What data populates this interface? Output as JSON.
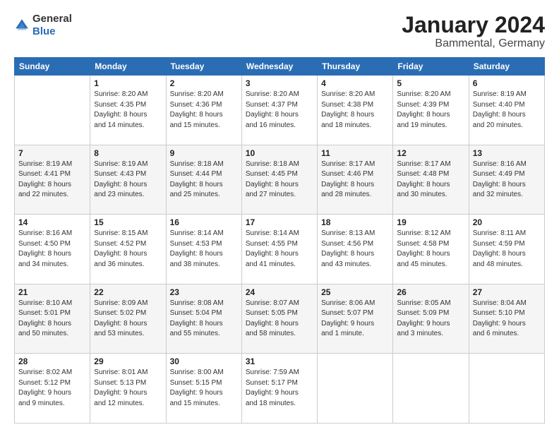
{
  "header": {
    "logo_general": "General",
    "logo_blue": "Blue",
    "month": "January 2024",
    "location": "Bammental, Germany"
  },
  "weekdays": [
    "Sunday",
    "Monday",
    "Tuesday",
    "Wednesday",
    "Thursday",
    "Friday",
    "Saturday"
  ],
  "weeks": [
    [
      {
        "day": "",
        "info": ""
      },
      {
        "day": "1",
        "info": "Sunrise: 8:20 AM\nSunset: 4:35 PM\nDaylight: 8 hours\nand 14 minutes."
      },
      {
        "day": "2",
        "info": "Sunrise: 8:20 AM\nSunset: 4:36 PM\nDaylight: 8 hours\nand 15 minutes."
      },
      {
        "day": "3",
        "info": "Sunrise: 8:20 AM\nSunset: 4:37 PM\nDaylight: 8 hours\nand 16 minutes."
      },
      {
        "day": "4",
        "info": "Sunrise: 8:20 AM\nSunset: 4:38 PM\nDaylight: 8 hours\nand 18 minutes."
      },
      {
        "day": "5",
        "info": "Sunrise: 8:20 AM\nSunset: 4:39 PM\nDaylight: 8 hours\nand 19 minutes."
      },
      {
        "day": "6",
        "info": "Sunrise: 8:19 AM\nSunset: 4:40 PM\nDaylight: 8 hours\nand 20 minutes."
      }
    ],
    [
      {
        "day": "7",
        "info": "Sunrise: 8:19 AM\nSunset: 4:41 PM\nDaylight: 8 hours\nand 22 minutes."
      },
      {
        "day": "8",
        "info": "Sunrise: 8:19 AM\nSunset: 4:43 PM\nDaylight: 8 hours\nand 23 minutes."
      },
      {
        "day": "9",
        "info": "Sunrise: 8:18 AM\nSunset: 4:44 PM\nDaylight: 8 hours\nand 25 minutes."
      },
      {
        "day": "10",
        "info": "Sunrise: 8:18 AM\nSunset: 4:45 PM\nDaylight: 8 hours\nand 27 minutes."
      },
      {
        "day": "11",
        "info": "Sunrise: 8:17 AM\nSunset: 4:46 PM\nDaylight: 8 hours\nand 28 minutes."
      },
      {
        "day": "12",
        "info": "Sunrise: 8:17 AM\nSunset: 4:48 PM\nDaylight: 8 hours\nand 30 minutes."
      },
      {
        "day": "13",
        "info": "Sunrise: 8:16 AM\nSunset: 4:49 PM\nDaylight: 8 hours\nand 32 minutes."
      }
    ],
    [
      {
        "day": "14",
        "info": "Sunrise: 8:16 AM\nSunset: 4:50 PM\nDaylight: 8 hours\nand 34 minutes."
      },
      {
        "day": "15",
        "info": "Sunrise: 8:15 AM\nSunset: 4:52 PM\nDaylight: 8 hours\nand 36 minutes."
      },
      {
        "day": "16",
        "info": "Sunrise: 8:14 AM\nSunset: 4:53 PM\nDaylight: 8 hours\nand 38 minutes."
      },
      {
        "day": "17",
        "info": "Sunrise: 8:14 AM\nSunset: 4:55 PM\nDaylight: 8 hours\nand 41 minutes."
      },
      {
        "day": "18",
        "info": "Sunrise: 8:13 AM\nSunset: 4:56 PM\nDaylight: 8 hours\nand 43 minutes."
      },
      {
        "day": "19",
        "info": "Sunrise: 8:12 AM\nSunset: 4:58 PM\nDaylight: 8 hours\nand 45 minutes."
      },
      {
        "day": "20",
        "info": "Sunrise: 8:11 AM\nSunset: 4:59 PM\nDaylight: 8 hours\nand 48 minutes."
      }
    ],
    [
      {
        "day": "21",
        "info": "Sunrise: 8:10 AM\nSunset: 5:01 PM\nDaylight: 8 hours\nand 50 minutes."
      },
      {
        "day": "22",
        "info": "Sunrise: 8:09 AM\nSunset: 5:02 PM\nDaylight: 8 hours\nand 53 minutes."
      },
      {
        "day": "23",
        "info": "Sunrise: 8:08 AM\nSunset: 5:04 PM\nDaylight: 8 hours\nand 55 minutes."
      },
      {
        "day": "24",
        "info": "Sunrise: 8:07 AM\nSunset: 5:05 PM\nDaylight: 8 hours\nand 58 minutes."
      },
      {
        "day": "25",
        "info": "Sunrise: 8:06 AM\nSunset: 5:07 PM\nDaylight: 9 hours\nand 1 minute."
      },
      {
        "day": "26",
        "info": "Sunrise: 8:05 AM\nSunset: 5:09 PM\nDaylight: 9 hours\nand 3 minutes."
      },
      {
        "day": "27",
        "info": "Sunrise: 8:04 AM\nSunset: 5:10 PM\nDaylight: 9 hours\nand 6 minutes."
      }
    ],
    [
      {
        "day": "28",
        "info": "Sunrise: 8:02 AM\nSunset: 5:12 PM\nDaylight: 9 hours\nand 9 minutes."
      },
      {
        "day": "29",
        "info": "Sunrise: 8:01 AM\nSunset: 5:13 PM\nDaylight: 9 hours\nand 12 minutes."
      },
      {
        "day": "30",
        "info": "Sunrise: 8:00 AM\nSunset: 5:15 PM\nDaylight: 9 hours\nand 15 minutes."
      },
      {
        "day": "31",
        "info": "Sunrise: 7:59 AM\nSunset: 5:17 PM\nDaylight: 9 hours\nand 18 minutes."
      },
      {
        "day": "",
        "info": ""
      },
      {
        "day": "",
        "info": ""
      },
      {
        "day": "",
        "info": ""
      }
    ]
  ]
}
